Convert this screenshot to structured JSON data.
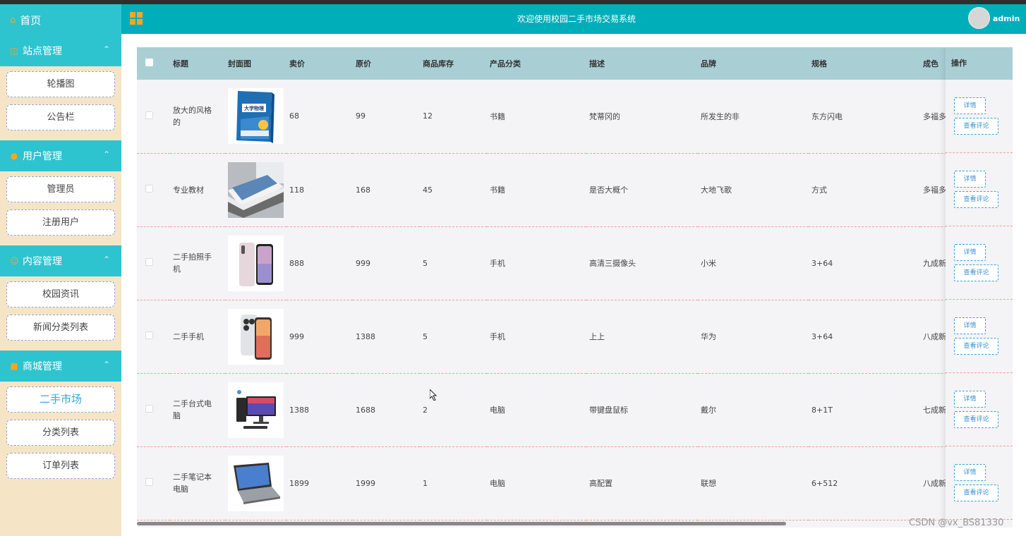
{
  "header": {
    "title": "欢迎使用校园二手市场交易系统",
    "username": "admin"
  },
  "sidebar": {
    "home": "首页",
    "groups": [
      {
        "title": "站点管理",
        "items": [
          "轮播图",
          "公告栏"
        ]
      },
      {
        "title": "用户管理",
        "items": [
          "管理员",
          "注册用户"
        ]
      },
      {
        "title": "内容管理",
        "items": [
          "校园资讯",
          "新闻分类列表"
        ]
      },
      {
        "title": "商城管理",
        "items": [
          "二手市场",
          "分类列表",
          "订单列表"
        ]
      }
    ]
  },
  "table": {
    "columns": [
      "标题",
      "封面图",
      "卖价",
      "原价",
      "商品库存",
      "产品分类",
      "描述",
      "品牌",
      "规格",
      "成色"
    ],
    "op_column": "操作",
    "detail_label": "详情",
    "review_label": "查看评论",
    "rows": [
      {
        "title": "放大的风格的",
        "price": "68",
        "original": "99",
        "stock": "12",
        "category": "书籍",
        "desc": "梵蒂冈的",
        "brand": "所发生的非",
        "spec": "东方闪电",
        "condition": "多福多"
      },
      {
        "title": "专业教材",
        "price": "118",
        "original": "168",
        "stock": "45",
        "category": "书籍",
        "desc": "是否大概个",
        "brand": "大地飞歌",
        "spec": "方式",
        "condition": "多福多"
      },
      {
        "title": "二手拍照手机",
        "price": "888",
        "original": "999",
        "stock": "5",
        "category": "手机",
        "desc": "高清三摄像头",
        "brand": "小米",
        "spec": "3+64",
        "condition": "九成新"
      },
      {
        "title": "二手手机",
        "price": "999",
        "original": "1388",
        "stock": "5",
        "category": "手机",
        "desc": "上上",
        "brand": "华为",
        "spec": "3+64",
        "condition": "八成新"
      },
      {
        "title": "二手台式电脑",
        "price": "1388",
        "original": "1688",
        "stock": "2",
        "category": "电脑",
        "desc": "带键盘鼠标",
        "brand": "戴尔",
        "spec": "8+1T",
        "condition": "七成新"
      },
      {
        "title": "二手笔记本电脑",
        "price": "1899",
        "original": "1999",
        "stock": "1",
        "category": "电脑",
        "desc": "高配置",
        "brand": "联想",
        "spec": "6+512",
        "condition": "八成新"
      }
    ]
  },
  "book_cover_text": "大学物理",
  "watermark": "CSDN @vx_BS81330",
  "colors": {
    "accent": "#00aeb9",
    "sidebar_bg": "#f5e4c6",
    "icon": "#f5a623",
    "table_header": "#a9cfd5",
    "row_divider": "#f0a393"
  }
}
